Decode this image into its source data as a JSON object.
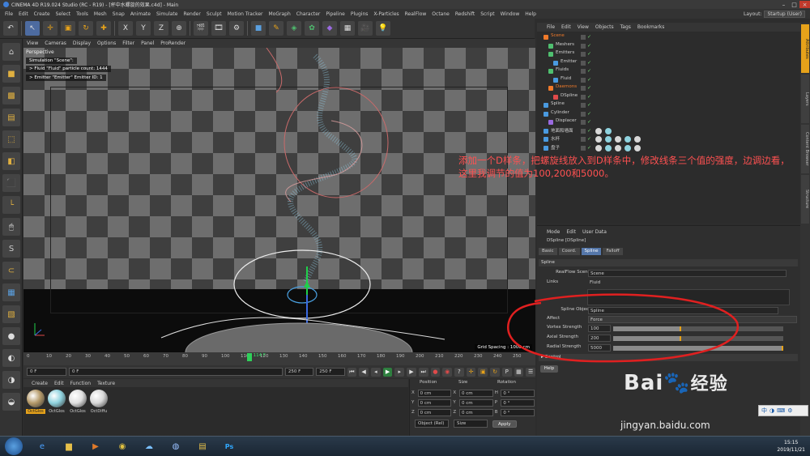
{
  "window": {
    "title": "CINEMA 4D R19.024 Studio (RC - R19) - [杯中水螺旋的效果.c4d] - Main"
  },
  "menubar": [
    "File",
    "Edit",
    "Create",
    "Select",
    "Tools",
    "Mesh",
    "Snap",
    "Animate",
    "Simulate",
    "Render",
    "Sculpt",
    "Motion Tracker",
    "MoGraph",
    "Character",
    "Pipeline",
    "Plugins",
    "X-Particles",
    "RealFlow",
    "Octane",
    "Redshift",
    "Script",
    "Window",
    "Help"
  ],
  "layout": {
    "label": "Layout:",
    "value": "Startup (User)"
  },
  "toolbar": {
    "axis_x": "X",
    "axis_y": "Y",
    "axis_z": "Z"
  },
  "viewport": {
    "menu": [
      "View",
      "Cameras",
      "Display",
      "Options",
      "Filter",
      "Panel",
      "ProRender"
    ],
    "label": "Perspective",
    "info_lines": [
      "Simulation \"Scene\":",
      "> Fluid \"Fluid\" particle count: 1444",
      "> Emitter \"Emitter\" Emitter ID: 1"
    ],
    "grid_spacing": "Grid Spacing : 1000 cm"
  },
  "timeline": {
    "ticks": [
      "0",
      "10",
      "20",
      "30",
      "40",
      "50",
      "60",
      "70",
      "80",
      "90",
      "100",
      "110",
      "120",
      "130",
      "140",
      "150",
      "160",
      "170",
      "180",
      "190",
      "200",
      "210",
      "220",
      "230",
      "240",
      "250"
    ],
    "current_frame": "114",
    "frame_readout": "114 F",
    "max_frame": 250,
    "start_field": "0 F",
    "min_field": "0 F",
    "end_field": "250 F",
    "max_field": "250 F"
  },
  "materials": {
    "menu": [
      "Create",
      "Edit",
      "Function",
      "Texture"
    ],
    "items": [
      {
        "label": "OctGlos",
        "color": "#b59a6a"
      },
      {
        "label": "OctGlos",
        "color": "#8fd3df"
      },
      {
        "label": "OctGlos",
        "color": "#e0e0e0"
      },
      {
        "label": "OctDiffu",
        "color": "#d8d8d8"
      }
    ]
  },
  "coords": {
    "headers": {
      "position": "Position",
      "size": "Size",
      "rotation": "Rotation"
    },
    "rows": [
      {
        "axis": "X",
        "pos": "0 cm",
        "size_axis": "X",
        "size": "0 cm",
        "rot_axis": "H",
        "rot": "0 °"
      },
      {
        "axis": "Y",
        "pos": "0 cm",
        "size_axis": "Y",
        "size": "0 cm",
        "rot_axis": "P",
        "rot": "0 °"
      },
      {
        "axis": "Z",
        "pos": "0 cm",
        "size_axis": "Z",
        "size": "0 cm",
        "rot_axis": "B",
        "rot": "0 °"
      }
    ],
    "mode_1": "Object (Rel)",
    "mode_2": "Size",
    "apply": "Apply"
  },
  "object_manager": {
    "menu": [
      "File",
      "Edit",
      "View",
      "Objects",
      "Tags",
      "Bookmarks"
    ],
    "objects": [
      {
        "name": "Scene",
        "indent": 0,
        "color": "#f07a2a",
        "selected": true
      },
      {
        "name": "Meshers",
        "indent": 1,
        "color": "#4fbf6f",
        "selected": false
      },
      {
        "name": "Emitters",
        "indent": 1,
        "color": "#4fbf6f",
        "selected": false
      },
      {
        "name": "Emitter",
        "indent": 2,
        "color": "#4a9ae0",
        "selected": false
      },
      {
        "name": "Fluids",
        "indent": 1,
        "color": "#4fbf6f",
        "selected": false
      },
      {
        "name": "Fluid",
        "indent": 2,
        "color": "#4a9ae0",
        "selected": false
      },
      {
        "name": "Daemons",
        "indent": 1,
        "color": "#f07a2a",
        "selected": true
      },
      {
        "name": "DSpline",
        "indent": 2,
        "color": "#e04a4a",
        "selected": false
      },
      {
        "name": "Spline",
        "indent": 0,
        "color": "#4a9ae0",
        "selected": false
      },
      {
        "name": "Cylinder",
        "indent": 0,
        "color": "#4a9ae0",
        "selected": false
      },
      {
        "name": "Displacer",
        "indent": 1,
        "color": "#9a6ae0",
        "selected": false
      },
      {
        "name": "地面和墙面",
        "indent": 0,
        "color": "#4a9ae0",
        "selected": false
      },
      {
        "name": "水杯",
        "indent": 0,
        "color": "#4a9ae0",
        "selected": false
      },
      {
        "name": "盘子",
        "indent": 0,
        "color": "#4a9ae0",
        "selected": false
      }
    ]
  },
  "attributes": {
    "menu": [
      "Mode",
      "Edit",
      "User Data"
    ],
    "title": "DSpline [DSpline]",
    "tabs": [
      "Basic",
      "Coord.",
      "Spline",
      "Falloff"
    ],
    "active_tab": "Spline",
    "section": "Spline",
    "realflow_scene_label": "RealFlow Scene",
    "realflow_scene_value": "Scene",
    "links_label": "Links",
    "links_value": "Fluid",
    "spline_object_label": "Spline Object",
    "spline_object_value": "Spline",
    "affect_label": "Affect",
    "affect_value": "Force",
    "params": [
      {
        "label": "Vortex Strength",
        "value": "100",
        "level": 0.4
      },
      {
        "label": "Axial Strength",
        "value": "200",
        "level": 0.4
      },
      {
        "label": "Radial Strength",
        "value": "5000",
        "level": 1.0
      }
    ],
    "control_section": "Control",
    "help": "Help"
  },
  "right_tabs": [
    "Attributes",
    "Layers",
    "Content Browser",
    "Structure"
  ],
  "annotation": "添加一个D样条，把螺旋线放入到D样条中，修改线条三个值的强度，边调边看，这里我调节的值为100,200和5000。",
  "watermark": {
    "brand": "Bai",
    "brand_cn": "经验",
    "url": "jingyan.baidu.com"
  },
  "taskbar": {
    "time": "15:15",
    "date": "2019/11/21",
    "ime_label": "中"
  },
  "colors": {
    "accent": "#e6a21a",
    "annotation_red": "#ff5151",
    "selection_orange": "#f07a2a"
  }
}
